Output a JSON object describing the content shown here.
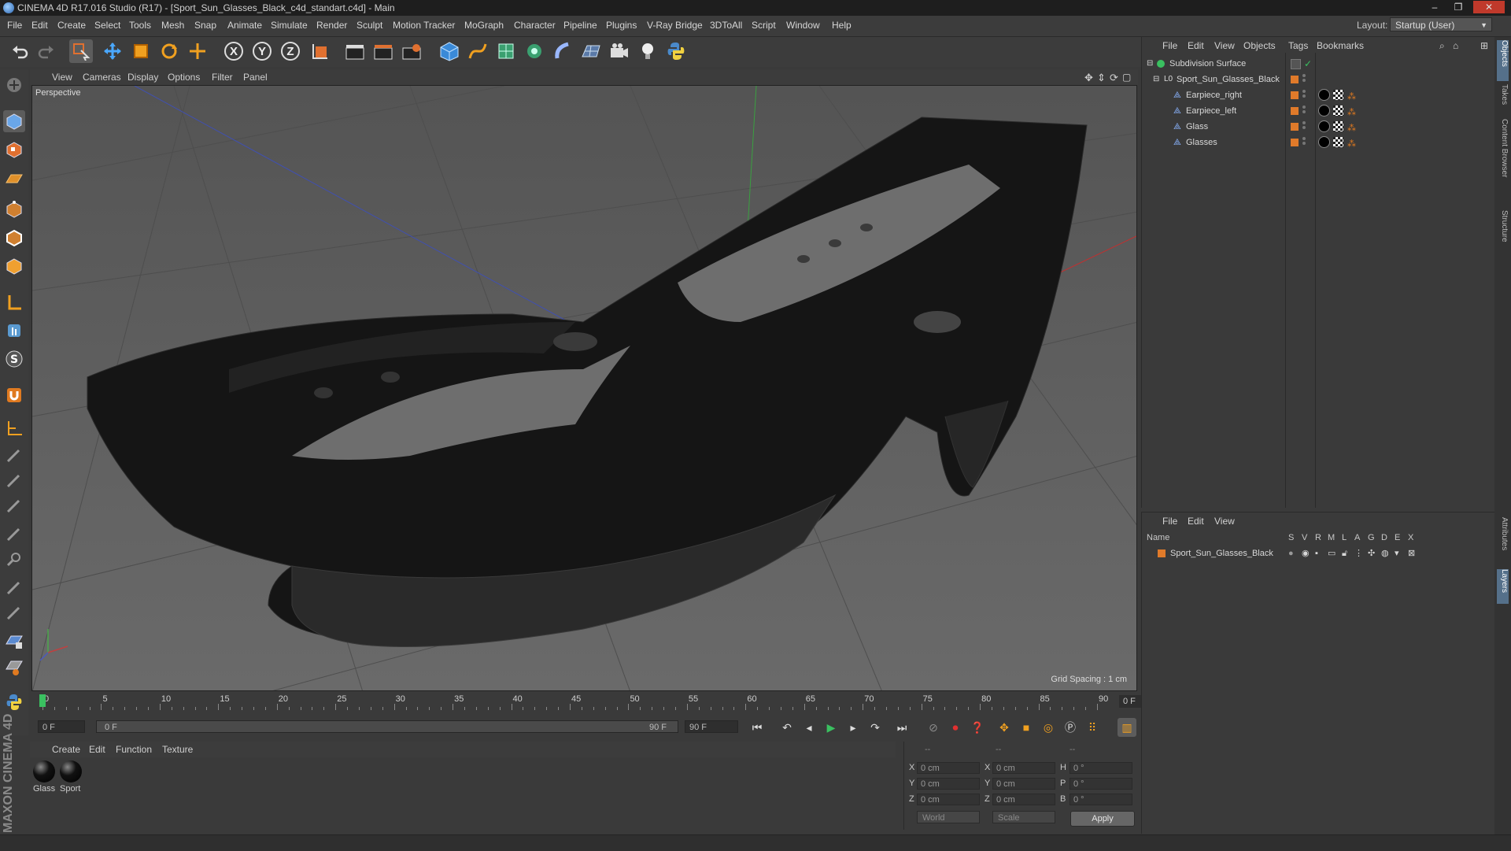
{
  "window": {
    "title": "CINEMA 4D R17.016 Studio (R17) - [Sport_Sun_Glasses_Black_c4d_standart.c4d] - Main",
    "minimize": "–",
    "maximize": "❐",
    "close": "✕"
  },
  "menubar": {
    "items": [
      "File",
      "Edit",
      "Create",
      "Select",
      "Tools",
      "Mesh",
      "Snap",
      "Animate",
      "Simulate",
      "Render",
      "Sculpt",
      "Motion Tracker",
      "MoGraph",
      "Character",
      "Pipeline",
      "Plugins",
      "V-Ray Bridge",
      "3DToAll",
      "Script",
      "Window",
      "Help"
    ],
    "layout_label": "Layout:",
    "layout_value": "Startup (User)"
  },
  "toolbar": {
    "axis_x": "X",
    "axis_y": "Y",
    "axis_z": "Z"
  },
  "viewport": {
    "menu": [
      "View",
      "Cameras",
      "Display",
      "Options",
      "Filter",
      "Panel"
    ],
    "label": "Perspective",
    "grid_spacing": "Grid Spacing : 1 cm"
  },
  "timeline": {
    "ticks": [
      "0",
      "5",
      "10",
      "15",
      "20",
      "25",
      "30",
      "35",
      "40",
      "45",
      "50",
      "55",
      "60",
      "65",
      "70",
      "75",
      "80",
      "85",
      "90"
    ],
    "frame_end": "0 F"
  },
  "transport": {
    "current_frame": "0 F",
    "range_start": "0 F",
    "range_end": "90 F",
    "max_frame": "90 F"
  },
  "material_manager": {
    "menu": [
      "Create",
      "Edit",
      "Function",
      "Texture"
    ],
    "materials": [
      "Glass",
      "Sport"
    ]
  },
  "coordinates": {
    "header": [
      "--",
      "--",
      "--"
    ],
    "rows": [
      {
        "l1": "X",
        "v1": "0 cm",
        "l2": "X",
        "v2": "0 cm",
        "l3": "H",
        "v3": "0 °"
      },
      {
        "l1": "Y",
        "v1": "0 cm",
        "l2": "Y",
        "v2": "0 cm",
        "l3": "P",
        "v3": "0 °"
      },
      {
        "l1": "Z",
        "v1": "0 cm",
        "l2": "Z",
        "v2": "0 cm",
        "l3": "B",
        "v3": "0 °"
      }
    ],
    "mode": "World",
    "transform": "Scale",
    "apply": "Apply"
  },
  "object_manager": {
    "menu": [
      "File",
      "Edit",
      "View",
      "Objects",
      "Tags",
      "Bookmarks"
    ],
    "objects": [
      {
        "name": "Subdivision Surface",
        "level": 0
      },
      {
        "name": "Sport_Sun_Glasses_Black",
        "level": 1
      },
      {
        "name": "Earpiece_right",
        "level": 2
      },
      {
        "name": "Earpiece_left",
        "level": 2
      },
      {
        "name": "Glass",
        "level": 2
      },
      {
        "name": "Glasses",
        "level": 2
      }
    ]
  },
  "layer_manager": {
    "menu": [
      "File",
      "Edit",
      "View"
    ],
    "name_header": "Name",
    "columns": [
      "S",
      "V",
      "R",
      "M",
      "L",
      "A",
      "G",
      "D",
      "E",
      "X"
    ],
    "layers": [
      "Sport_Sun_Glasses_Black"
    ]
  },
  "side_tabs": [
    "Objects",
    "Takes",
    "Content Browser",
    "Structure",
    "Attributes",
    "Layers"
  ],
  "branding": "MAXON CINEMA 4D"
}
